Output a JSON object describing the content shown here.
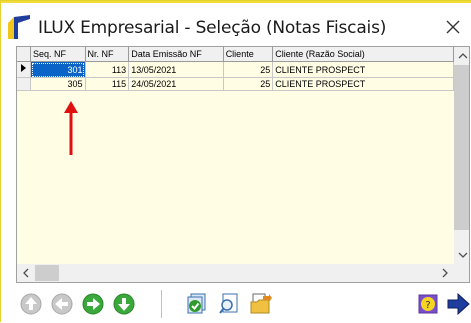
{
  "window": {
    "title": "ILUX Empresarial - Seleção (Notas Fiscais)"
  },
  "grid": {
    "columns": [
      "Seq. NF",
      "Nr. NF",
      "Data Emissão NF",
      "Cliente",
      "Cliente (Razão Social)"
    ],
    "rows": [
      {
        "seq_nf": "301",
        "nr_nf": "113",
        "data_emissao": "13/05/2021",
        "cliente": "25",
        "razao_social": "CLIENTE PROSPECT",
        "selected": true
      },
      {
        "seq_nf": "305",
        "nr_nf": "115",
        "data_emissao": "24/05/2021",
        "cliente": "25",
        "razao_social": "CLIENTE PROSPECT",
        "selected": false
      }
    ]
  },
  "toolbar": {
    "buttons": [
      {
        "name": "nav-up-button",
        "icon": "arrow-up-gray-icon",
        "enabled": false
      },
      {
        "name": "nav-back-button",
        "icon": "arrow-left-gray-icon",
        "enabled": false
      },
      {
        "name": "nav-forward-button",
        "icon": "arrow-right-green-icon",
        "enabled": true
      },
      {
        "name": "nav-down-button",
        "icon": "arrow-down-green-icon",
        "enabled": true
      },
      {
        "name": "confirm-button",
        "icon": "check-pages-icon",
        "enabled": true
      },
      {
        "name": "search-button",
        "icon": "magnifier-page-icon",
        "enabled": true
      },
      {
        "name": "open-folder-button",
        "icon": "folder-arrow-icon",
        "enabled": true
      },
      {
        "name": "help-button",
        "icon": "help-icon",
        "enabled": true
      },
      {
        "name": "exit-button",
        "icon": "exit-arrow-icon",
        "enabled": true
      }
    ]
  },
  "colors": {
    "grid_background": "#fffde3",
    "selected_cell": "#0a64c8",
    "title_accent": "#1f3d9c",
    "annotation_arrow": "#e01010"
  }
}
